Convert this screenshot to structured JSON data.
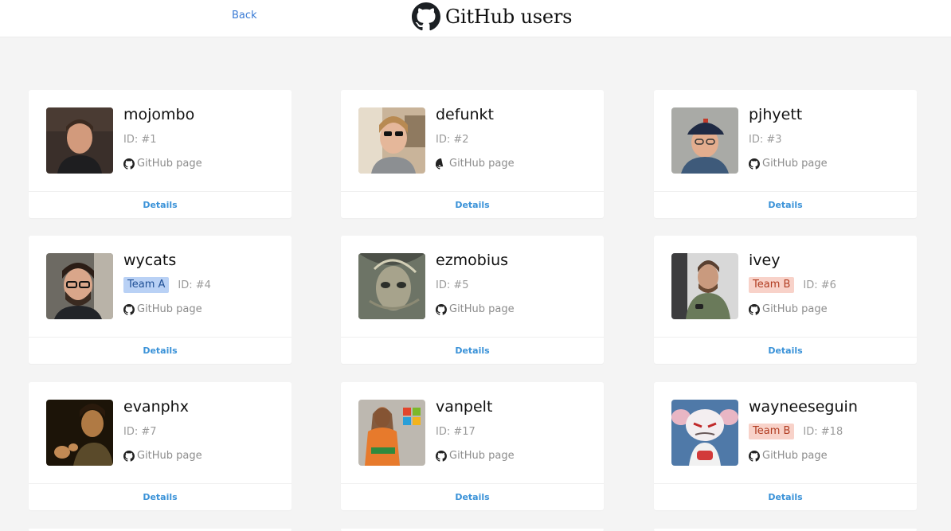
{
  "header": {
    "back_label": "Back",
    "title": "GitHub users"
  },
  "colors": {
    "page_bg": "#f4f4f4",
    "link_blue": "#3a7bd5",
    "details_blue": "#3a92d8",
    "team_a_bg": "#b9d1f5",
    "team_b_bg": "#f8d2c9"
  },
  "cards": [
    {
      "login": "mojombo",
      "id_text": "ID: #1",
      "link_label": "GitHub page",
      "details_label": "Details",
      "team": ""
    },
    {
      "login": "defunkt",
      "id_text": "ID: #2",
      "link_label": "GitHub page",
      "details_label": "Details",
      "team": ""
    },
    {
      "login": "pjhyett",
      "id_text": "ID: #3",
      "link_label": "GitHub page",
      "details_label": "Details",
      "team": ""
    },
    {
      "login": "wycats",
      "id_text": "ID: #4",
      "link_label": "GitHub page",
      "details_label": "Details",
      "team": "Team A"
    },
    {
      "login": "ezmobius",
      "id_text": "ID: #5",
      "link_label": "GitHub page",
      "details_label": "Details",
      "team": ""
    },
    {
      "login": "ivey",
      "id_text": "ID: #6",
      "link_label": "GitHub page",
      "details_label": "Details",
      "team": "Team B"
    },
    {
      "login": "evanphx",
      "id_text": "ID: #7",
      "link_label": "GitHub page",
      "details_label": "Details",
      "team": ""
    },
    {
      "login": "vanpelt",
      "id_text": "ID: #17",
      "link_label": "GitHub page",
      "details_label": "Details",
      "team": ""
    },
    {
      "login": "wayneeseguin",
      "id_text": "ID: #18",
      "link_label": "GitHub page",
      "details_label": "Details",
      "team": "Team B"
    }
  ]
}
